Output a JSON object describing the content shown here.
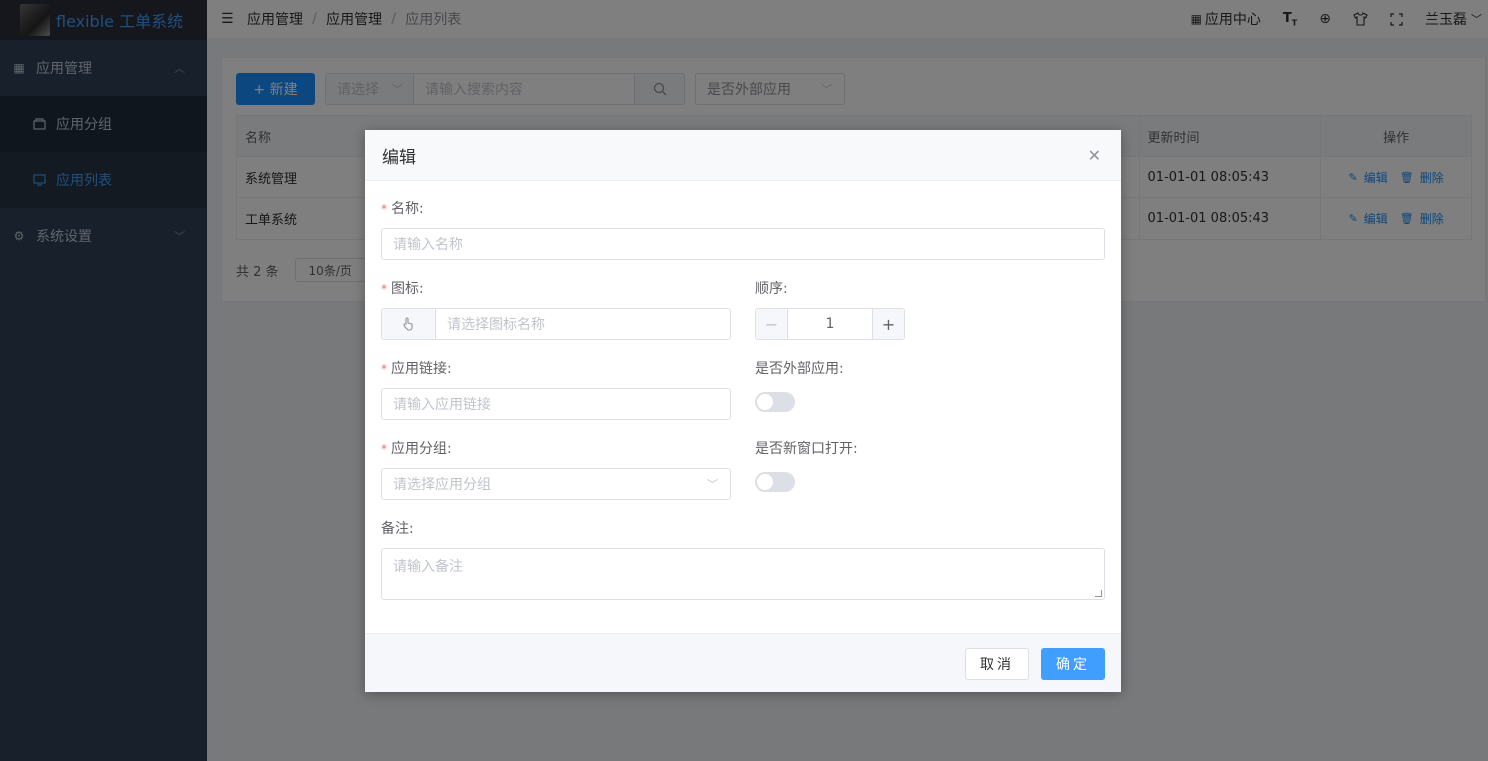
{
  "app": {
    "name": "flexible 工单系统"
  },
  "sidebar": {
    "items": [
      {
        "label": "应用管理",
        "icon": "grid-icon",
        "expanded": true
      },
      {
        "label": "应用分组",
        "icon": "folder-icon"
      },
      {
        "label": "应用列表",
        "icon": "monitor-icon",
        "active": true
      },
      {
        "label": "系统设置",
        "icon": "gear-icon",
        "expanded": false
      }
    ]
  },
  "header": {
    "breadcrumb": [
      "应用管理",
      "应用管理",
      "应用列表"
    ],
    "app_center": "应用中心",
    "user": "兰玉磊"
  },
  "toolbar": {
    "new_label": "+ 新建",
    "select_placeholder": "请选择",
    "search_placeholder": "请输入搜索内容",
    "external_placeholder": "是否外部应用"
  },
  "table": {
    "headers": {
      "name": "名称",
      "updated": "更新时间",
      "ops": "操作"
    },
    "rows": [
      {
        "name": "系统管理",
        "updated": "01-01-01 08:05:43"
      },
      {
        "name": "工单系统",
        "updated": "01-01-01 08:05:43"
      }
    ],
    "edit_label": "编辑",
    "delete_label": "删除"
  },
  "pager": {
    "total": "共 2 条",
    "size": "10条/页"
  },
  "dialog": {
    "title": "编辑",
    "fields": {
      "name_label": "名称:",
      "name_placeholder": "请输入名称",
      "icon_label": "图标:",
      "icon_placeholder": "请选择图标名称",
      "order_label": "顺序:",
      "order_value": "1",
      "link_label": "应用链接:",
      "link_placeholder": "请输入应用链接",
      "external_label": "是否外部应用:",
      "group_label": "应用分组:",
      "group_placeholder": "请选择应用分组",
      "newwin_label": "是否新窗口打开:",
      "remark_label": "备注:",
      "remark_placeholder": "请输入备注"
    },
    "cancel_label": "取消",
    "ok_label": "确定"
  },
  "colors": {
    "primary": "#409eff",
    "sidebar": "#304156",
    "required": "#f56c6c"
  }
}
